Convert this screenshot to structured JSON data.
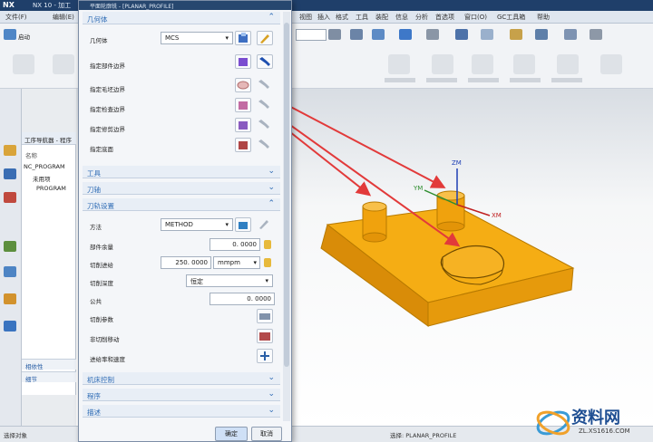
{
  "window": {
    "app_logo": "NX",
    "title": "NX 10 - 加工"
  },
  "menubar": {
    "items": [
      "文件(F)",
      "编辑(E)",
      "视图",
      "插入",
      "格式",
      "工具",
      "装配",
      "信息",
      "分析",
      "首选项",
      "窗口(O)",
      "GC工具箱",
      "帮助"
    ]
  },
  "ribbon": {
    "start_label": "启动"
  },
  "navigator": {
    "title": "工序导航器 - 程序",
    "column_header": "名称",
    "rows": [
      "NC_PROGRAM",
      "未用项",
      "PROGRAM"
    ],
    "footer_items": [
      "相依性",
      "细节"
    ]
  },
  "dialog": {
    "title": "平面轮廓铣 - [PLANAR_PROFILE]",
    "sections": {
      "geometry": "几何体",
      "tool": "工具",
      "tool_axis": "刀轴",
      "tool_path": "刀轨设置",
      "machine_control": "机床控制",
      "program": "程序",
      "description": "描述"
    },
    "geometry": {
      "label": "几何体",
      "value": "MCS",
      "rows": [
        "指定部件边界",
        "指定毛坯边界",
        "指定检查边界",
        "指定修剪边界",
        "指定底面"
      ]
    },
    "tool_path": {
      "method_label": "方法",
      "method_value": "METHOD",
      "wall_stock_label": "部件余量",
      "wall_stock_value": "0. 0000",
      "feed_label": "切削进给",
      "feed_value": "250. 0000",
      "feed_unit": "mmpm",
      "depth_label": "切削深度",
      "depth_value": "恒定",
      "common_label": "公共",
      "common_value": "0. 0000",
      "cut_params_label": "切削参数",
      "non_cut_label": "非切削移动",
      "feeds_speeds_label": "进给率和速度"
    },
    "ok_label": "确定",
    "cancel_label": "取消"
  },
  "viewport": {
    "axis_labels": [
      "ZM",
      "YM",
      "XM"
    ]
  },
  "statusbar": {
    "left_text": "选择对象",
    "right_text": "选择: PLANAR_PROFILE"
  },
  "watermark": {
    "line1": "资料网",
    "line2": "ZL.XS1616.COM"
  },
  "colors": {
    "part": "#f2a50f",
    "arrow": "#e23a3a",
    "section_header": "#2f6cb5",
    "title_bar": "#1f3f6a"
  }
}
